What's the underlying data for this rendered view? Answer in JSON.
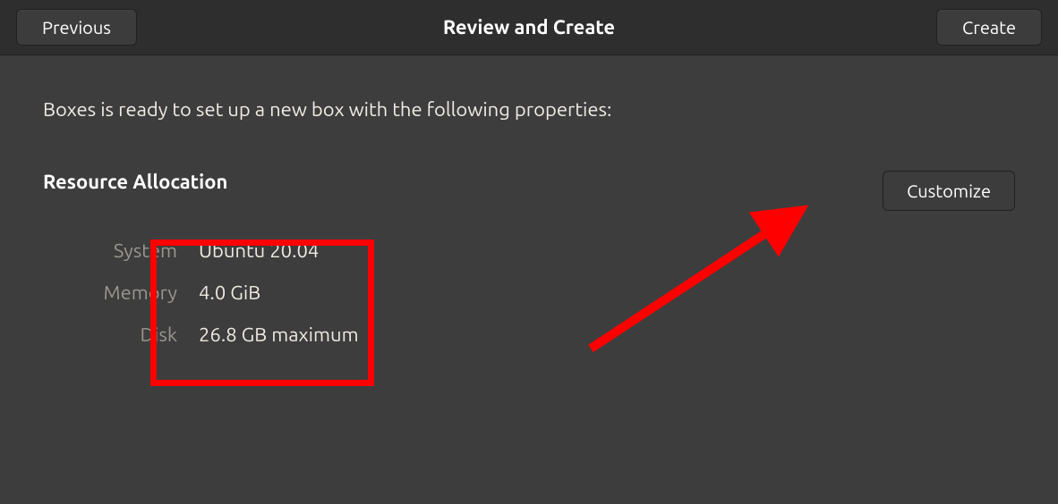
{
  "header": {
    "previous_label": "Previous",
    "title": "Review and Create",
    "create_label": "Create"
  },
  "body": {
    "intro": "Boxes is ready to set up a new box with the following properties:",
    "section_heading": "Resource Allocation",
    "customize_label": "Customize",
    "props": {
      "system_label": "System",
      "system_value": "Ubuntu 20.04",
      "memory_label": "Memory",
      "memory_value": "4.0 GiB",
      "disk_label": "Disk",
      "disk_value": "26.8 GB maximum"
    }
  },
  "annotations": {
    "highlight_color": "#ff0000"
  }
}
